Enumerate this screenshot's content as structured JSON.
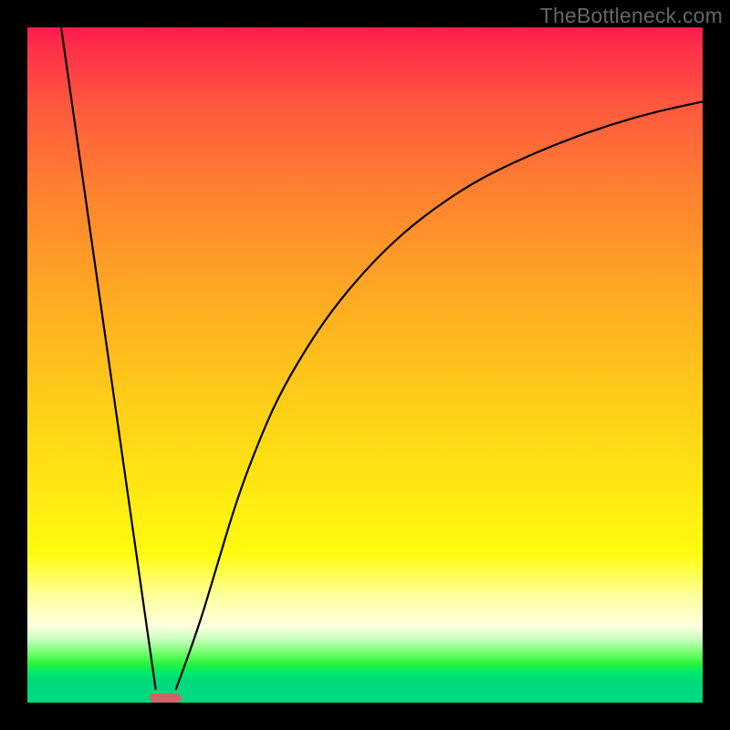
{
  "watermark": "TheBottleneck.com",
  "chart_data": {
    "type": "line",
    "title": "",
    "xlabel": "",
    "ylabel": "",
    "xlim": [
      0,
      100
    ],
    "ylim": [
      0,
      100
    ],
    "grid": false,
    "legend": false,
    "series": [
      {
        "name": "left-branch",
        "x": [
          5,
          19
        ],
        "y": [
          100,
          2
        ]
      },
      {
        "name": "right-branch",
        "x": [
          22,
          25,
          28,
          31,
          34,
          37,
          41,
          45,
          50,
          55,
          60,
          66,
          72,
          79,
          86,
          93,
          100
        ],
        "y": [
          2,
          10,
          20,
          30,
          38,
          45,
          52,
          58,
          64,
          69,
          73,
          77,
          80,
          83,
          85.5,
          87.5,
          89
        ]
      }
    ],
    "marker": {
      "name": "optimal-bar",
      "x_center": 20.5,
      "width_pct": 4.7,
      "color": "#cc6666"
    },
    "background_gradient": {
      "top": "#ff1a4d",
      "mid_upper": "#ff8030",
      "mid": "#ffe712",
      "mid_lower": "#ffffde",
      "bottom": "#00d97e"
    }
  }
}
